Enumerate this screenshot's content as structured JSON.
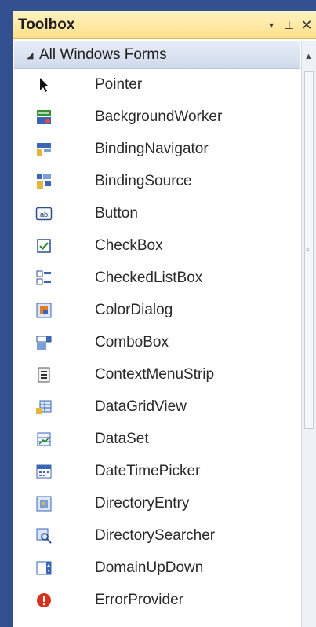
{
  "toolbox": {
    "title": "Toolbox",
    "controls": {
      "dropdown_glyph": "▾",
      "pin_glyph": "⊥",
      "close_glyph": "✕"
    },
    "group": {
      "expander_glyph": "◢",
      "label": "All Windows Forms"
    },
    "items": [
      {
        "label": "Pointer",
        "icon": "pointer-icon"
      },
      {
        "label": "BackgroundWorker",
        "icon": "background-worker-icon"
      },
      {
        "label": "BindingNavigator",
        "icon": "binding-navigator-icon"
      },
      {
        "label": "BindingSource",
        "icon": "binding-source-icon"
      },
      {
        "label": "Button",
        "icon": "button-icon"
      },
      {
        "label": "CheckBox",
        "icon": "checkbox-icon"
      },
      {
        "label": "CheckedListBox",
        "icon": "checked-list-box-icon"
      },
      {
        "label": "ColorDialog",
        "icon": "color-dialog-icon"
      },
      {
        "label": "ComboBox",
        "icon": "combobox-icon"
      },
      {
        "label": "ContextMenuStrip",
        "icon": "context-menu-strip-icon"
      },
      {
        "label": "DataGridView",
        "icon": "data-grid-view-icon"
      },
      {
        "label": "DataSet",
        "icon": "dataset-icon"
      },
      {
        "label": "DateTimePicker",
        "icon": "date-time-picker-icon"
      },
      {
        "label": "DirectoryEntry",
        "icon": "directory-entry-icon"
      },
      {
        "label": "DirectorySearcher",
        "icon": "directory-searcher-icon"
      },
      {
        "label": "DomainUpDown",
        "icon": "domain-up-down-icon"
      },
      {
        "label": "ErrorProvider",
        "icon": "error-provider-icon"
      }
    ],
    "scrollbar": {
      "up_glyph": "▲",
      "grip_glyph": "≡"
    },
    "colors": {
      "titlebar": "#ffe08a",
      "selection": "#ffffff",
      "accent": "#324f8f"
    }
  }
}
